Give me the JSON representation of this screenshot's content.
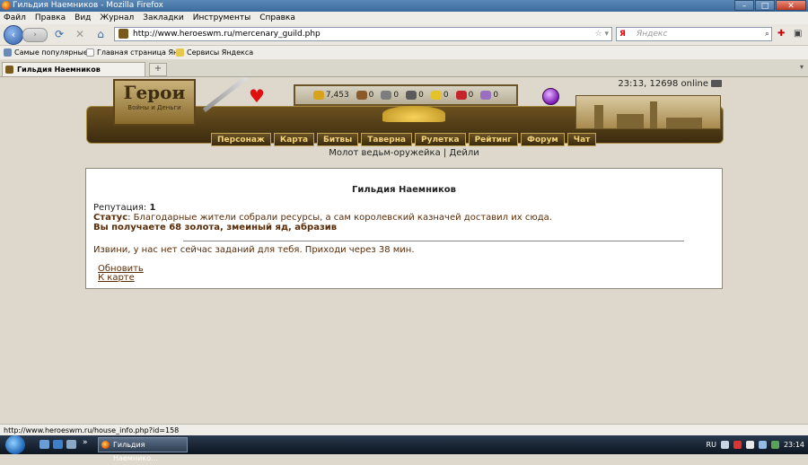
{
  "window": {
    "title": "Гильдия Наемников - Mozilla Firefox",
    "minimize": "–",
    "maximize": "□",
    "close": "✕"
  },
  "menu": [
    "Файл",
    "Правка",
    "Вид",
    "Журнал",
    "Закладки",
    "Инструменты",
    "Справка"
  ],
  "navbar": {
    "back": "‹",
    "forward": "›",
    "reload": "⟳",
    "stop": "✕",
    "home": "⌂",
    "url": "http://www.heroeswm.ru/mercenary_guild.php",
    "url_icons": "☆ ▾",
    "search_brand": "Я",
    "search_placeholder": "Яндекс",
    "search_icon": "⌕"
  },
  "bookmarks": [
    "Самые популярные",
    "Главная страница Ян...",
    "Сервисы Яндекса"
  ],
  "tab": {
    "title": "Гильдия Наемников",
    "new_tab": "+"
  },
  "page": {
    "server_status": "23:13, 12698 online",
    "logo_text": "Герои",
    "logo_subtext": "Войны и Деньги",
    "resources": [
      {
        "icon": "gold-icon",
        "value": "7,453",
        "color": "#d9a21b"
      },
      {
        "icon": "wood-icon",
        "value": "0",
        "color": "#8a5a2b"
      },
      {
        "icon": "ore-icon",
        "value": "0",
        "color": "#7d7d7d"
      },
      {
        "icon": "mercury-icon",
        "value": "0",
        "color": "#5a5a5a"
      },
      {
        "icon": "sulfur-icon",
        "value": "0",
        "color": "#e6c229"
      },
      {
        "icon": "crystal-icon",
        "value": "0",
        "color": "#c4242a"
      },
      {
        "icon": "gems-icon",
        "value": "0",
        "color": "#9a6fc2"
      }
    ],
    "nav": [
      "Персонаж",
      "Карта",
      "Битвы",
      "Таверна",
      "Рулетка",
      "Рейтинг",
      "Форум",
      "Чат"
    ],
    "sublinks": "Молот ведьм-оружейка | Дейли",
    "guild": {
      "title": "Гильдия Наемников",
      "reputation_label": "Репутация: ",
      "reputation_value": "1",
      "status_label": "Статус",
      "status_text": ": Благодарные жители собрали ресурсы, а сам королевский казначей доставил их сюда.",
      "reward": "Вы получаете 68 золота, змеиный яд, абразив",
      "message": "Извини, у нас нет сейчас заданий для тебя. Приходи через 38 мин.",
      "refresh_link": "Обновить",
      "map_link": "К карте"
    }
  },
  "statusbar": "http://www.heroeswm.ru/house_info.php?id=158",
  "taskbar": {
    "item": "Гильдия Наемнико...",
    "lang": "RU",
    "clock": "23:14",
    "arrows": "»"
  }
}
